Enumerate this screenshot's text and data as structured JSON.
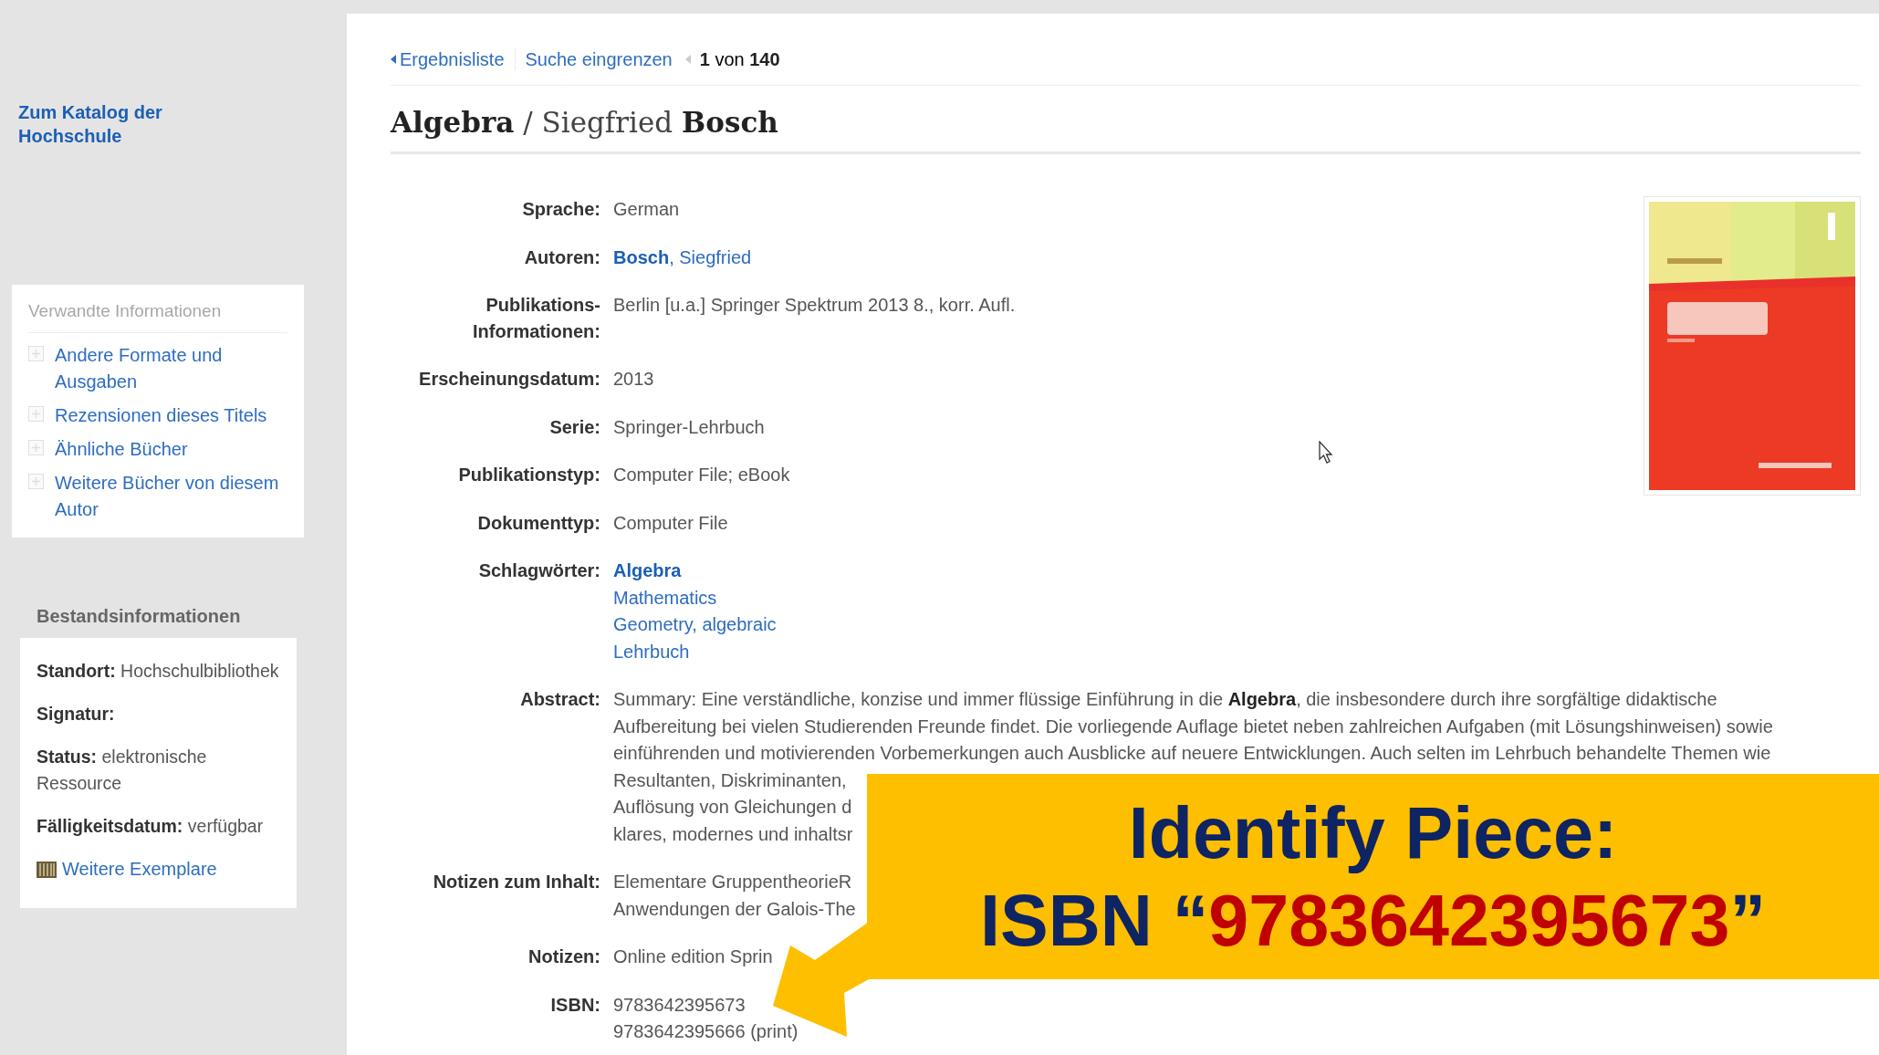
{
  "sidebar": {
    "catalog_link": "Zum Katalog der Hochschule",
    "related": {
      "heading": "Verwandte Informationen",
      "items": [
        "Andere Formate und Ausgaben",
        "Rezensionen dieses Titels",
        "Ähnliche Bücher",
        "Weitere Bücher von diesem Autor"
      ]
    },
    "holdings": {
      "heading": "Bestandsinformationen",
      "fields": [
        "**Standort:** Hochschulbibliothek",
        "**Signatur:**",
        "**Status:** elektronische Ressource",
        "**Fälligkeitsdatum:** verfügbar"
      ],
      "link": "Weitere Exemplare"
    }
  },
  "nav": {
    "back": "Ergebnisliste",
    "refine": "Suche eingrenzen",
    "position": "**1** von **140**"
  },
  "title": "**Algebra** / Siegfried **Bosch**",
  "details": [
    {
      "label": "Sprache:",
      "kind": "text",
      "lines": [
        "German"
      ]
    },
    {
      "label": "Autoren:",
      "kind": "link",
      "lines": [
        "**Bosch**, Siegfried"
      ]
    },
    {
      "label": "Publikations-Informationen:",
      "kind": "text",
      "lines": [
        "Berlin [u.a.] Springer Spektrum 2013 8., korr. Aufl."
      ]
    },
    {
      "label": "Erscheinungsdatum:",
      "kind": "text",
      "lines": [
        "2013"
      ]
    },
    {
      "label": "Serie:",
      "kind": "text",
      "lines": [
        "Springer-Lehrbuch"
      ]
    },
    {
      "label": "Publikationstyp:",
      "kind": "text",
      "lines": [
        "Computer File; eBook"
      ]
    },
    {
      "label": "Dokumenttyp:",
      "kind": "text",
      "lines": [
        "Computer File"
      ]
    },
    {
      "label": "Schlagwörter:",
      "kind": "link",
      "lines": [
        "**Algebra**",
        "Mathematics",
        "Geometry, algebraic",
        "Lehrbuch"
      ]
    },
    {
      "label": "Abstract:",
      "kind": "text",
      "lines": [
        "Summary: Eine verständliche, konzise und immer flüssige Einführung in die **Algebra**, die insbesondere durch ihre sorgfältige didaktische",
        "Aufbereitung bei vielen Studierenden Freunde findet. Die vorliegende Auflage bietet neben zahlreichen Aufgaben (mit Lösungshinweisen) sowie",
        "einführenden und motivierenden Vorbemerkungen auch Ausblicke auf neuere Entwicklungen. Auch selten im Lehrbuch behandelte Themen wie",
        "Resultanten, Diskriminanten,",
        "Auflösung von Gleichungen d",
        "klares, modernes und inhaltsr"
      ]
    },
    {
      "label": "Notizen zum Inhalt:",
      "kind": "text",
      "lines": [
        "Elementare GruppentheorieR",
        "Anwendungen der Galois-The"
      ]
    },
    {
      "label": "Notizen:",
      "kind": "text",
      "lines": [
        "Online edition Sprin"
      ]
    },
    {
      "label": "ISBN:",
      "kind": "text",
      "lines": [
        "9783642395673",
        "9783642395666 (print)"
      ]
    }
  ],
  "callout": {
    "line1": "Identify Piece:",
    "prefix": "ISBN “",
    "number": "9783642395673",
    "suffix": "”"
  }
}
